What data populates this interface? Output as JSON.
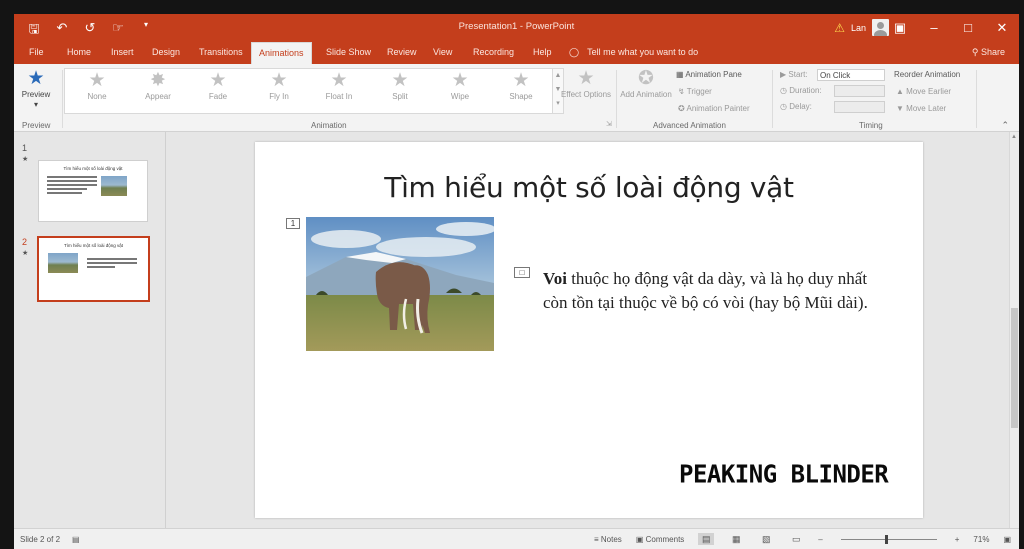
{
  "window": {
    "title": "Presentation1 - PowerPoint",
    "user": "Lan",
    "qat_icons": [
      "save-icon",
      "undo-icon",
      "redo-icon",
      "touch-mode-icon",
      "customize-qat-icon"
    ],
    "window_buttons": [
      "ribbon-display-icon",
      "minimize-icon",
      "maximize-icon",
      "close-icon"
    ]
  },
  "tabs": [
    "File",
    "Home",
    "Insert",
    "Design",
    "Transitions",
    "Animations",
    "Slide Show",
    "Review",
    "View",
    "Recording",
    "Help"
  ],
  "active_tab": "Animations",
  "tell_me": "Tell me what you want to do",
  "share": "Share",
  "ribbon": {
    "preview": {
      "label": "Preview",
      "group": "Preview"
    },
    "animation_group": "Animation",
    "effects": [
      "None",
      "Appear",
      "Fade",
      "Fly In",
      "Float In",
      "Split",
      "Wipe",
      "Shape"
    ],
    "effect_options": "Effect Options",
    "add_animation": "Add Animation",
    "advanced_group": "Advanced Animation",
    "animation_pane": "Animation Pane",
    "trigger": "Trigger",
    "animation_painter": "Animation Painter",
    "timing_group": "Timing",
    "start_label": "Start:",
    "start_value": "On Click",
    "duration_label": "Duration:",
    "delay_label": "Delay:",
    "reorder": "Reorder Animation",
    "move_earlier": "Move Earlier",
    "move_later": "Move Later"
  },
  "thumbnails": [
    {
      "num": "1",
      "title": "Tìm hiểu một số loài động vật"
    },
    {
      "num": "2",
      "title": "Tìm hiểu một số loài động vật"
    }
  ],
  "selected_slide": 2,
  "slide": {
    "title": "Tìm hiểu một số loài động vật",
    "anim_tag_image": "1",
    "body_bold": "Voi",
    "body_rest": " thuộc họ động vật da dày, và là họ duy nhất còn tồn tại thuộc về bộ có vòi (hay bộ Mũi dài).",
    "watermark": "PEAKING BLINDER"
  },
  "status": {
    "slide_info": "Slide 2 of 2",
    "notes": "Notes",
    "comments": "Comments",
    "zoom": "71%"
  }
}
